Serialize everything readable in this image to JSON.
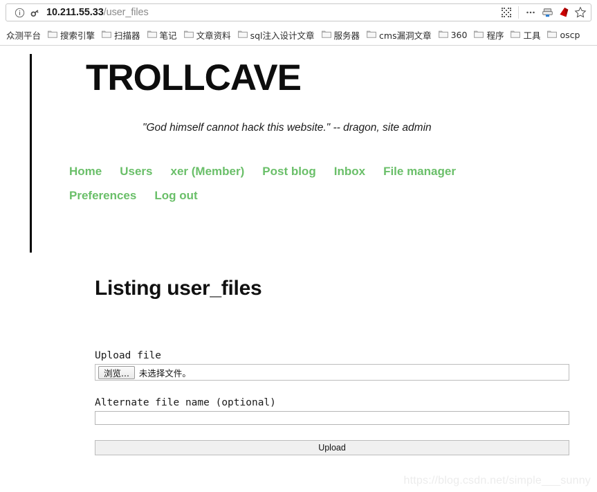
{
  "browser": {
    "url_host": "10.211.55.33",
    "url_path": "/user_files",
    "icons": {
      "info": "info-icon",
      "key": "key-icon",
      "qr": "qr-code-icon",
      "more": "more-options-icon",
      "save_page": "save-to-pocket-icon",
      "ruby": "ruby-extension-icon",
      "bookmark": "star-bookmark-icon"
    },
    "bookmarks": [
      {
        "label": "众测平台",
        "has_folder_icon": false
      },
      {
        "label": "搜索引擎",
        "has_folder_icon": true
      },
      {
        "label": "扫描器",
        "has_folder_icon": true
      },
      {
        "label": "笔记",
        "has_folder_icon": true
      },
      {
        "label": "文章资料",
        "has_folder_icon": true
      },
      {
        "label": "sql注入设计文章",
        "has_folder_icon": true
      },
      {
        "label": "服务器",
        "has_folder_icon": true
      },
      {
        "label": "cms漏洞文章",
        "has_folder_icon": true
      },
      {
        "label": "360",
        "has_folder_icon": true
      },
      {
        "label": "程序",
        "has_folder_icon": true
      },
      {
        "label": "工具",
        "has_folder_icon": true
      },
      {
        "label": "oscp",
        "has_folder_icon": true
      }
    ]
  },
  "site": {
    "title": "TROLLCAVE",
    "tagline": "\"God himself cannot hack this website.\" -- dragon, site admin",
    "accent_color": "#6abf69",
    "nav": [
      {
        "label": "Home"
      },
      {
        "label": "Users"
      },
      {
        "label": "xer (Member)"
      },
      {
        "label": "Post blog"
      },
      {
        "label": "Inbox"
      },
      {
        "label": "File manager"
      },
      {
        "label": "Preferences"
      },
      {
        "label": "Log out"
      }
    ]
  },
  "main": {
    "heading": "Listing user_files",
    "form": {
      "upload_file_label": "Upload file",
      "browse_button_label": "浏览...",
      "file_status_text": "未选择文件。",
      "alternate_name_label": "Alternate file name (optional)",
      "alternate_name_value": "",
      "alternate_name_placeholder": "",
      "submit_label": "Upload"
    }
  },
  "watermark": "https://blog.csdn.net/simple___sunny"
}
